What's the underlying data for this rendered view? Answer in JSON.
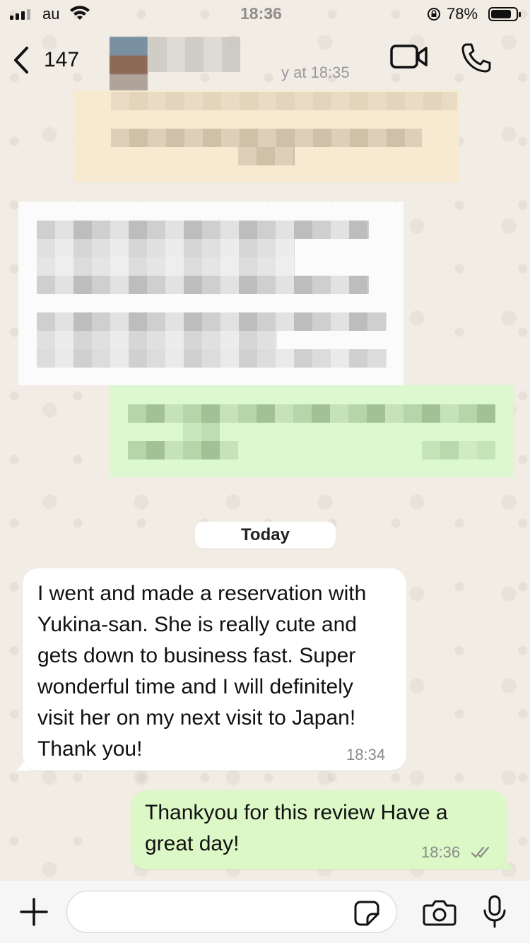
{
  "status_bar": {
    "carrier": "au",
    "time": "18:36",
    "battery_percent": "78%",
    "battery_level": 0.78,
    "signal_icon": "signal-bars-icon",
    "wifi_icon": "wifi-icon",
    "rotation_lock_icon": "rotation-lock-icon"
  },
  "header": {
    "contact_name": "147",
    "last_seen": "y at 18:35",
    "back_icon": "chevron-left-icon",
    "video_icon": "video-camera-icon",
    "call_icon": "phone-icon"
  },
  "chat": {
    "date_label": "Today",
    "messages": [
      {
        "direction": "incoming",
        "text": "I went and made a reservation with Yukina-san. She is really cute and gets down to business fast. Super wonderful time and I will definitely visit her on my next visit to Japan! Thank you!",
        "time": "18:34"
      },
      {
        "direction": "outgoing",
        "text": "Thankyou for this review Have a great day!",
        "time": "18:36",
        "status": "read"
      }
    ]
  },
  "input_bar": {
    "value": "",
    "placeholder": "",
    "plus_icon": "plus-icon",
    "sticker_icon": "sticker-icon",
    "camera_icon": "camera-icon",
    "mic_icon": "microphone-icon"
  },
  "colors": {
    "outgoing_bubble": "#dcf8c6",
    "incoming_bubble": "#ffffff",
    "wallpaper": "#efeae2"
  }
}
